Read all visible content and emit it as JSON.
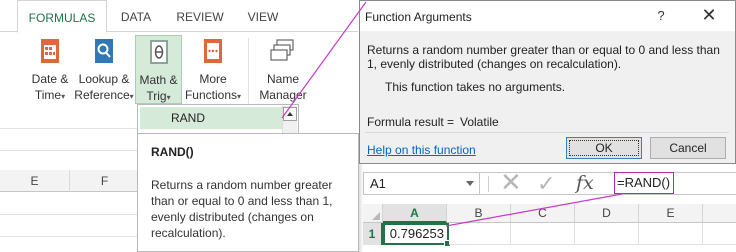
{
  "ribbon": {
    "tabs": [
      {
        "label": "FORMULAS",
        "active": true
      },
      {
        "label": "DATA"
      },
      {
        "label": "REVIEW"
      },
      {
        "label": "VIEW"
      }
    ],
    "groups": [
      {
        "line1": "Date &",
        "line2": "Time",
        "icon": "calendar-icon"
      },
      {
        "line1": "Lookup &",
        "line2": "Reference",
        "icon": "magnifier-book-icon"
      },
      {
        "line1": "Math &",
        "line2": "Trig",
        "icon": "theta-book-icon"
      },
      {
        "line1": "More",
        "line2": "Functions",
        "icon": "more-functions-icon"
      },
      {
        "line1": "Name",
        "line2": "Manager",
        "icon": "name-tags-icon"
      }
    ],
    "caret": "▾"
  },
  "left_sheet": {
    "columns": [
      "E",
      "F"
    ]
  },
  "dropdown": {
    "selected_item": "RAND"
  },
  "tooltip": {
    "title": "RAND()",
    "body": "Returns a random number greater than or equal to 0 and less than 1, evenly distributed (changes on recalculation)."
  },
  "dialog": {
    "title": "Function Arguments",
    "help_symbol": "?",
    "close_symbol": "✕",
    "description": "Returns a random number greater than or equal to 0 and less than 1, evenly distributed (changes on recalculation).",
    "no_args_text": "This function takes no arguments.",
    "result_label": "Formula result =",
    "result_value": "Volatile",
    "help_link": "Help on this function",
    "ok_label": "OK",
    "cancel_label": "Cancel"
  },
  "formula_bar": {
    "name_box": "A1",
    "cancel_glyph": "✕",
    "enter_glyph": "✓",
    "fx_label": "fx",
    "formula": "=RAND()"
  },
  "grid": {
    "columns": [
      "A",
      "B",
      "C",
      "D",
      "E"
    ],
    "row_label": "1",
    "a1_value": "0.796253"
  },
  "colors": {
    "accent_green": "#217346",
    "callout_magenta": "#c83bc8",
    "math_trig_highlight": "#d6ead9"
  }
}
